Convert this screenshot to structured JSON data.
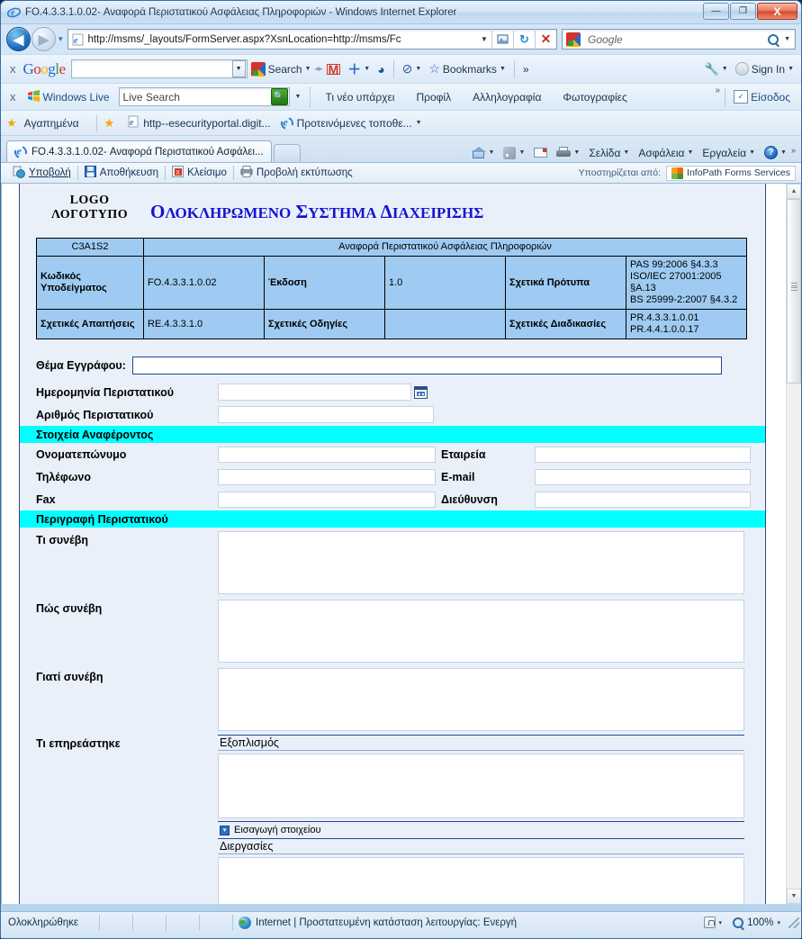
{
  "window": {
    "title": "FO.4.3.3.1.0.02- Αναφορά Περιστατικού Ασφάλειας Πληροφοριών - Windows Internet Explorer",
    "minimize_label": "—",
    "maximize_label": "❐",
    "close_label": "X"
  },
  "address_bar": {
    "back_label": "◀",
    "forward_label": "▶",
    "recent_label": "▾",
    "url": "http://msms/_layouts/FormServer.aspx?XsnLocation=http://msms/Fc",
    "url_host": "msms",
    "url_prefix": "http://",
    "url_suffix": "/_layouts/FormServer.aspx?XsnLocation=http://msms/Fc",
    "compat_icon": "compatibility-view-icon",
    "refresh_label": "↻",
    "stop_label": "✕",
    "search_placeholder": "Google",
    "search_go_label": "🔍"
  },
  "google_toolbar": {
    "close_label": "x",
    "logo": "Google",
    "input_value": "",
    "search_label": "Search",
    "gmail_label": "M",
    "share_label": "＋",
    "translate_label": "◕",
    "popup_blocker_label": "⊘",
    "bookmarks_label": "Bookmarks",
    "overflow_label": "»",
    "settings_label": "🔧",
    "signin_label": "Sign In"
  },
  "live_toolbar": {
    "close_label": "x",
    "brand": "Windows Live",
    "search_value": "Live Search",
    "links": [
      "Τι νέο υπάρχει",
      "Προφίλ",
      "Αλληλογραφία",
      "Φωτογραφίες"
    ],
    "overflow_label": "»",
    "signin_label": "Είσοδος"
  },
  "favorites_bar": {
    "favorites_label": "Αγαπημένα",
    "items": [
      {
        "label": "http--esecurityportal.digit...",
        "icon": "ie-page-icon"
      },
      {
        "label": "Προτεινόμενες τοποθε...",
        "icon": "ie-icon"
      }
    ],
    "dropdown_label": "▾"
  },
  "tabs": {
    "active_tab": "FO.4.3.3.1.0.02- Αναφορά Περιστατικού Ασφάλει...",
    "new_tab_label": "",
    "commands": [
      {
        "label": "",
        "icon": "home-icon",
        "caret": "▾"
      },
      {
        "label": "",
        "icon": "rss-icon",
        "caret": "▾"
      },
      {
        "label": "",
        "icon": "mail-icon",
        "caret": ""
      },
      {
        "label": "",
        "icon": "print-icon",
        "caret": "▾"
      },
      {
        "label": "Σελίδα",
        "icon": "",
        "caret": "▾"
      },
      {
        "label": "Ασφάλεια",
        "icon": "",
        "caret": "▾"
      },
      {
        "label": "Εργαλεία",
        "icon": "",
        "caret": "▾"
      },
      {
        "label": "",
        "icon": "help-icon",
        "caret": "▾"
      }
    ],
    "overflow_label": "»"
  },
  "infopath_bar": {
    "items": [
      {
        "label": "Υποβολή",
        "icon": "submit-icon"
      },
      {
        "label": "Αποθήκευση",
        "icon": "save-icon"
      },
      {
        "label": "Κλείσιμο",
        "icon": "close-doc-icon"
      },
      {
        "label": "Προβολή εκτύπωσης",
        "icon": "print-preview-icon"
      }
    ],
    "powered_by_label": "Υποστηρίζεται από:",
    "product_name": "InfoPath Forms Services"
  },
  "form": {
    "logo_line1": "LOGO",
    "logo_line2": "ΛΟΓΟΤΥΠΟ",
    "main_title_parts": [
      {
        "big": "Ο",
        "rest": "ΛΟΚΛΗΡΩΜΕΝΟ"
      },
      {
        "big": "Σ",
        "rest": "ΥΣΤΗΜΑ"
      },
      {
        "big": "Δ",
        "rest": "ΙΑΧΕΙΡΙΣΗΣ"
      }
    ],
    "header_table": {
      "code": "C3A1S2",
      "doc_title": "Αναφορά Περιστατικού Ασφάλειας Πληροφοριών",
      "rows": [
        {
          "label1": "Κωδικός Υποδείγματος",
          "value1": "FO.4.3.3.1.0.02",
          "label2": "Έκδοση",
          "value2": "1.0",
          "label3": "Σχετικά Πρότυπα",
          "value3": "PAS 99:2006 §4.3.3\nISO/IEC 27001:2005 §A.13\nBS 25999-2:2007 §4.3.2"
        },
        {
          "label1": "Σχετικές Απαιτήσεις",
          "value1": "RE.4.3.3.1.0",
          "label2": "Σχετικές Οδηγίες",
          "value2": "",
          "label3": "Σχετικές Διαδικασίες",
          "value3": "PR.4.3.3.1.0.01\nPR.4.4.1.0.0.17"
        }
      ]
    },
    "subject_label": "Θέμα Εγγράφου:",
    "subject_value": "",
    "incident_date_label": "Ημερομηνία Περιστατικού",
    "incident_date_value": "",
    "incident_number_label": "Αριθμός Περιστατικού",
    "incident_number_value": "",
    "section_reporter": "Στοιχεία Αναφέροντος",
    "reporter_fields": [
      {
        "label_left": "Ονοματεπώνυμο",
        "value_left": "",
        "label_right": "Εταιρεία",
        "value_right": ""
      },
      {
        "label_left": "Τηλέφωνο",
        "value_left": "",
        "label_right": "E-mail",
        "value_right": ""
      },
      {
        "label_left": "Fax",
        "value_left": "",
        "label_right": "Διεύθυνση",
        "value_right": ""
      }
    ],
    "section_description": "Περιγραφή Περιστατικού",
    "description_fields": [
      {
        "label": "Τι συνέβη",
        "value": ""
      },
      {
        "label": "Πώς συνέβη",
        "value": ""
      },
      {
        "label": "Γιατί συνέβη",
        "value": ""
      }
    ],
    "affected_label": "Τι επηρεάστηκε",
    "affected_groups": [
      {
        "title": "Εξοπλισμός",
        "value": "",
        "insert_label": "Εισαγωγή στοιχείου"
      },
      {
        "title": "Διεργασίες",
        "value": ""
      }
    ],
    "calendar_icon": "calendar-picker-icon",
    "colors": {
      "title_blue": "#1414d0",
      "table_fill": "#9fcbf2",
      "band_cyan": "#00ffff",
      "form_bg": "#eaf0fa"
    }
  },
  "status_bar": {
    "left_text": "Ολοκληρώθηκε",
    "zone_text": "Internet | Προστατευμένη κατάσταση λειτουργίας: Ενεργή",
    "zone_icon": "internet-globe-icon",
    "privacy_icon": "privacy-lock-icon",
    "privacy_caret": "▾",
    "zoom_level": "100%",
    "zoom_caret": "▾"
  }
}
